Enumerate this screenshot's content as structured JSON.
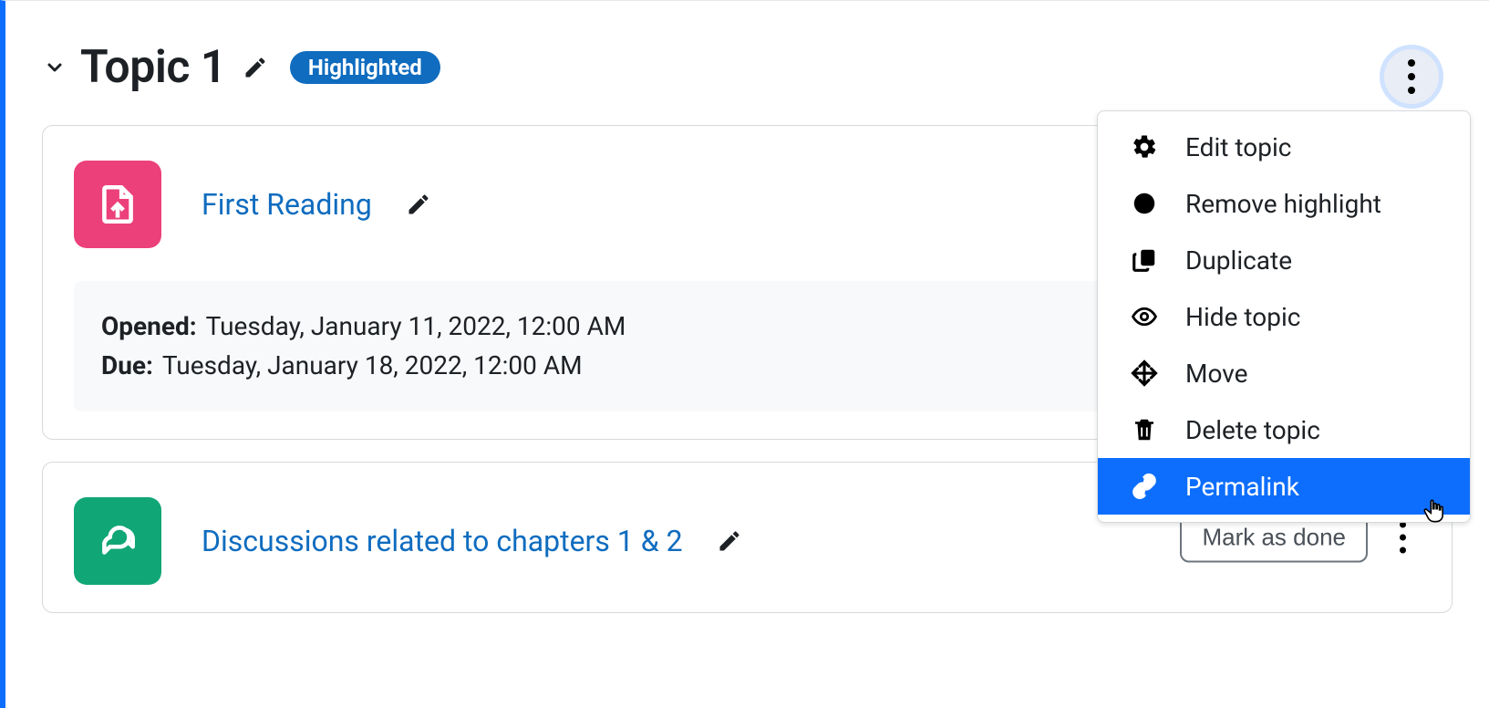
{
  "topic": {
    "title": "Topic 1",
    "badge": "Highlighted"
  },
  "activity1": {
    "title": "First Reading",
    "opened_label": "Opened:",
    "opened_value": "Tuesday, January 11, 2022, 12:00 AM",
    "due_label": "Due:",
    "due_value": "Tuesday, January 18, 2022, 12:00 AM"
  },
  "activity2": {
    "title": "Discussions related to chapters 1 & 2",
    "mark_done": "Mark as done"
  },
  "menu": {
    "edit_topic": "Edit topic",
    "remove_highlight": "Remove highlight",
    "duplicate": "Duplicate",
    "hide_topic": "Hide topic",
    "move": "Move",
    "delete_topic": "Delete topic",
    "permalink": "Permalink"
  }
}
